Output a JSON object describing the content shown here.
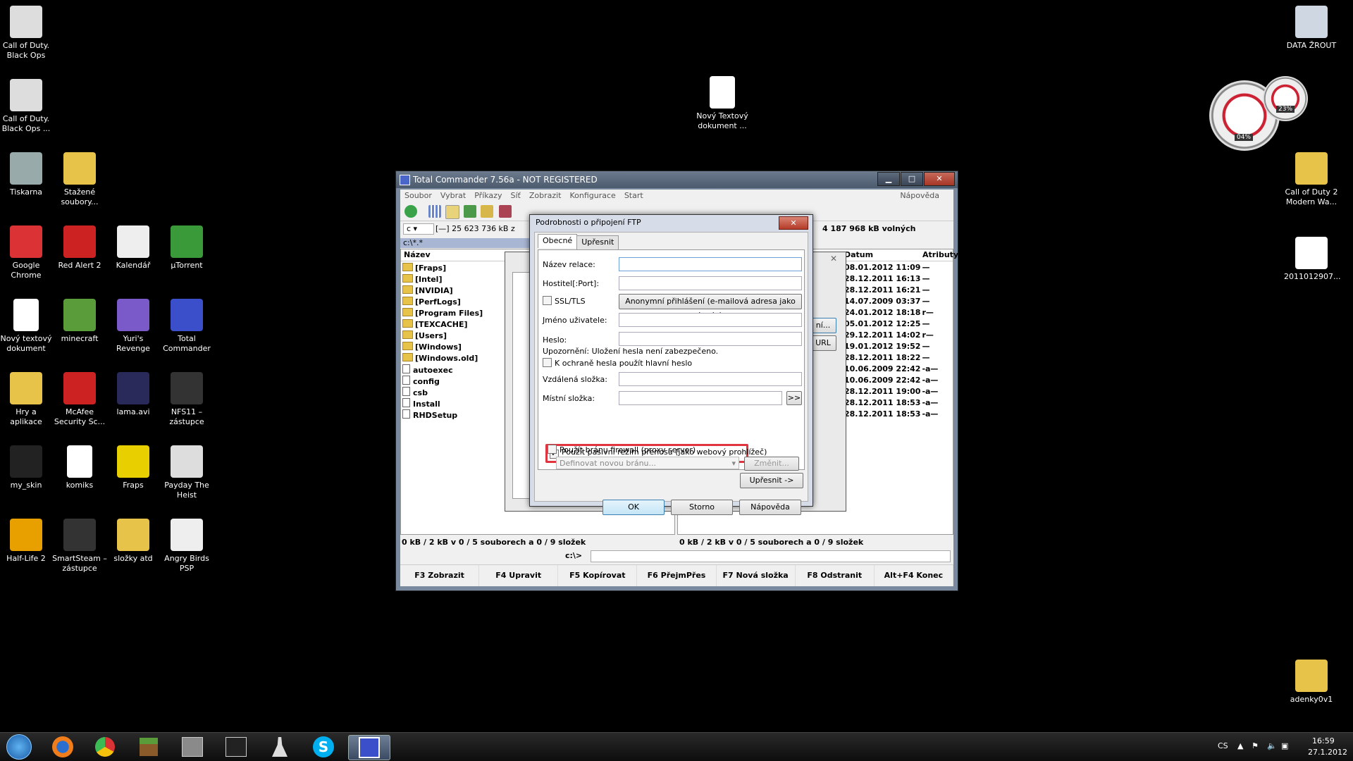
{
  "desktop": {
    "icons": [
      {
        "label": "Call of Duty. Black Ops",
        "icon": "cod-skull-icon"
      },
      {
        "label": "Call of Duty. Black Ops ...",
        "icon": "cod-skull-icon"
      },
      {
        "label": "Tiskarna",
        "icon": "printer-icon"
      },
      {
        "label": "Stažené soubory...",
        "icon": "folder-icon"
      },
      {
        "label": "Google Chrome",
        "icon": "chrome-icon"
      },
      {
        "label": "Red Alert 2",
        "icon": "red-alert-icon"
      },
      {
        "label": "Kalendář",
        "icon": "calendar-icon"
      },
      {
        "label": "µTorrent",
        "icon": "utorrent-icon"
      },
      {
        "label": "Nový textový dokument",
        "icon": "text-document-icon"
      },
      {
        "label": "minecraft",
        "icon": "minecraft-icon"
      },
      {
        "label": "Yuri's Revenge",
        "icon": "yuri-icon"
      },
      {
        "label": "Total Commander",
        "icon": "floppy-icon"
      },
      {
        "label": "Hry a aplikace",
        "icon": "folder-icon"
      },
      {
        "label": "McAfee Security Sc...",
        "icon": "mcafee-icon"
      },
      {
        "label": "lama.avi",
        "icon": "after-effects-icon"
      },
      {
        "label": "NFS11 – zástupce",
        "icon": "nfs-icon"
      },
      {
        "label": "my_skin",
        "icon": "skin-icon"
      },
      {
        "label": "komiks",
        "icon": "document-icon"
      },
      {
        "label": "Fraps",
        "icon": "fraps-icon"
      },
      {
        "label": "Payday The Heist",
        "icon": "payday-mask-icon"
      },
      {
        "label": "Half-Life 2",
        "icon": "half-life-icon"
      },
      {
        "label": "SmartSteam – zástupce",
        "icon": "steam-icon"
      },
      {
        "label": "složky atd",
        "icon": "folder-icon"
      },
      {
        "label": "Angry Birds PSP",
        "icon": "disc-icon"
      },
      {
        "label": "Nový Textový dokument ...",
        "icon": "text-document-icon"
      },
      {
        "label": "DATA ŽROUT",
        "icon": "recycle-bin-icon"
      },
      {
        "label": "Call of Duty 2 Modern Wa...",
        "icon": "folder-icon"
      },
      {
        "label": "2011012907...",
        "icon": "image-icon"
      },
      {
        "label": "adenky0v1",
        "icon": "seven-icon"
      }
    ],
    "gadget": {
      "cpu": "04%",
      "ram": "23%"
    }
  },
  "window": {
    "title": "Total Commander 7.56a - NOT REGISTERED",
    "buttons": {
      "minimize": "▁",
      "maximize": "□",
      "close": "✕"
    },
    "menu": [
      "Soubor",
      "Vybrat",
      "Příkazy",
      "Síť",
      "Zobrazit",
      "Konfigurace",
      "Start"
    ],
    "menu_help": "Nápověda",
    "left_drive": "c",
    "left_drive_info": "[—]  25 623 736 kB z",
    "right_drive_info": "4 187 968 kB volných",
    "left_path": "c:\\*.*",
    "left_col": "Název",
    "right_cols": {
      "date": "Datum",
      "attr": "Atributy"
    },
    "left_files": [
      {
        "name": "[Fraps]",
        "type": "folder"
      },
      {
        "name": "[Intel]",
        "type": "folder"
      },
      {
        "name": "[NVIDIA]",
        "type": "folder"
      },
      {
        "name": "[PerfLogs]",
        "type": "folder"
      },
      {
        "name": "[Program Files]",
        "type": "folder"
      },
      {
        "name": "[TEXCACHE]",
        "type": "folder"
      },
      {
        "name": "[Users]",
        "type": "folder"
      },
      {
        "name": "[Windows]",
        "type": "folder"
      },
      {
        "name": "[Windows.old]",
        "type": "folder"
      },
      {
        "name": "autoexec",
        "type": "file"
      },
      {
        "name": "config",
        "type": "file"
      },
      {
        "name": "csb",
        "type": "file"
      },
      {
        "name": "Install",
        "type": "file"
      },
      {
        "name": "RHDSetup",
        "type": "file"
      }
    ],
    "right_rows": [
      {
        "date": "08.01.2012 11:09",
        "attr": "—"
      },
      {
        "date": "28.12.2011 16:13",
        "attr": "—"
      },
      {
        "date": "28.12.2011 16:21",
        "attr": "—"
      },
      {
        "date": "14.07.2009 03:37",
        "attr": "—"
      },
      {
        "date": "24.01.2012 18:18",
        "attr": "r—"
      },
      {
        "date": "05.01.2012 12:25",
        "attr": "—"
      },
      {
        "date": "29.12.2011 14:02",
        "attr": "r—"
      },
      {
        "date": "19.01.2012 19:52",
        "attr": "—"
      },
      {
        "date": "28.12.2011 18:22",
        "attr": "—"
      },
      {
        "date": "10.06.2009 22:42",
        "attr": "-a—"
      },
      {
        "date": "10.06.2009 22:42",
        "attr": "-a—"
      },
      {
        "date": "28.12.2011 19:00",
        "attr": "-a—"
      },
      {
        "date": "28.12.2011 18:53",
        "attr": "-a—"
      },
      {
        "date": "28.12.2011 18:53",
        "attr": "-a—"
      }
    ],
    "left_status": "0 kB / 2 kB v 0 / 5 souborech a 0 / 9 složek",
    "right_status": "0 kB / 2 kB v 0 / 5 souborech a 0 / 9 složek",
    "cmd_path": "c:\\>",
    "fkeys": [
      "F3 Zobrazit",
      "F4 Upravit",
      "F5 Kopírovat",
      "F6 PřejmPřes",
      "F7 Nová složka",
      "F8 Odstranit",
      "Alt+F4 Konec"
    ],
    "back_dialog": {
      "side_buttons": [
        "ní...",
        "URL"
      ]
    }
  },
  "dialog": {
    "title": "Podrobnosti o připojení FTP",
    "tabs": [
      "Obecné",
      "Upřesnit"
    ],
    "labels": {
      "session": "Název relace:",
      "host": "Hostitel[:Port]:",
      "ssl": "SSL/TLS",
      "anon": "Anonymní přihlášení (e-mailová adresa jako heslo)",
      "user": "Jméno uživatele:",
      "password": "Heslo:",
      "warning": "Upozornění: Uložení hesla není zabezpečeno.",
      "master": "K ochraně hesla použít hlavní heslo",
      "remote": "Vzdálená složka:",
      "local": "Místní složka:",
      "browse": ">>",
      "passive": "Použít pasivní režim přenosu (jako webový prohlížeč)",
      "firewall": "Použít bránu firewall (proxy server)",
      "proxy_select": "Definovat novou bránu...",
      "change": "Změnit...",
      "advanced": "Upřesnit ->"
    },
    "buttons": {
      "ok": "OK",
      "cancel": "Storno",
      "help": "Nápověda"
    }
  },
  "taskbar": {
    "lang": "CS",
    "time": "16:59",
    "date": "27.1.2012",
    "apps": [
      "start-orb-icon",
      "firefox-icon",
      "chrome-icon",
      "minecraft-icon",
      "cs-icon",
      "nfs-icon",
      "counter-strike-icon",
      "skype-icon",
      "total-commander-icon"
    ]
  }
}
